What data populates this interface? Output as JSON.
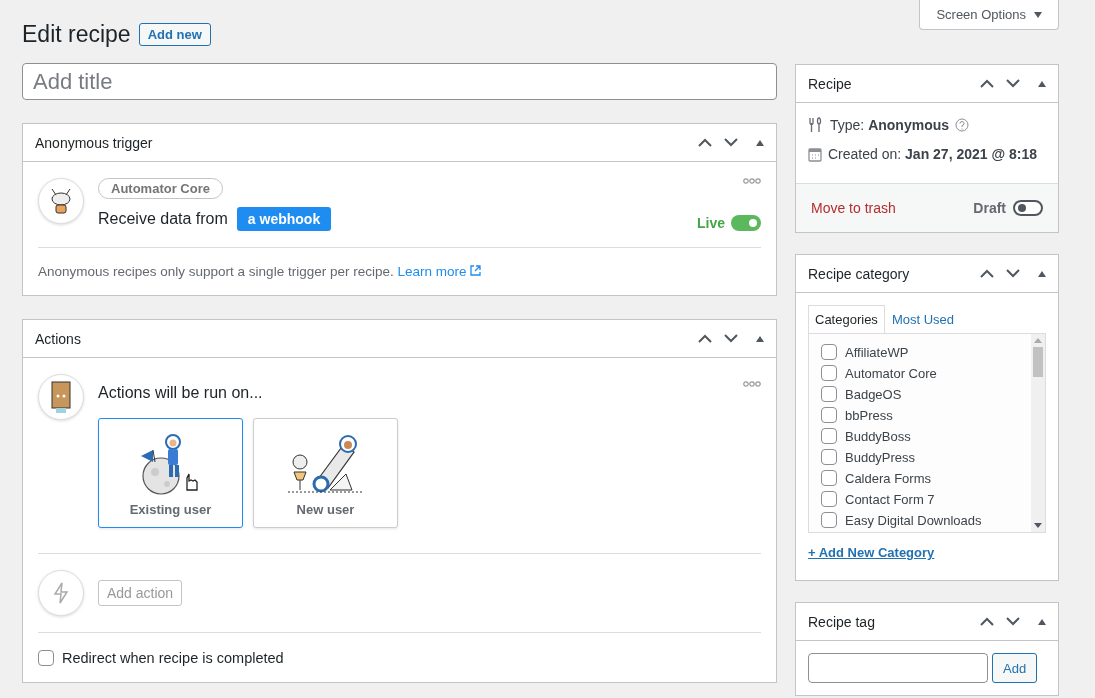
{
  "page": {
    "title": "Edit recipe",
    "add_new": "Add new",
    "screen_options": "Screen Options"
  },
  "title_field": {
    "placeholder": "Add title"
  },
  "trigger_panel": {
    "title": "Anonymous trigger",
    "integration": "Automator Core",
    "sentence": "Receive data from",
    "token": "a webhook",
    "status": {
      "label": "Live",
      "on": true
    },
    "note": "Anonymous recipes only support a single trigger per recipe.",
    "link": "Learn more"
  },
  "actions_panel": {
    "title": "Actions",
    "prompt": "Actions will be run on...",
    "options": [
      {
        "label": "Existing user",
        "selected": true
      },
      {
        "label": "New user",
        "selected": false
      }
    ],
    "add_action": "Add action",
    "redirect": {
      "label": "Redirect when recipe is completed",
      "checked": false
    }
  },
  "recipe_box": {
    "title": "Recipe",
    "type": "Type: **Anonymous**",
    "created": "Created on: **Jan 27, 2021 @ 8:18**",
    "trash": "Move to trash",
    "status": {
      "label": "Draft",
      "on": false
    }
  },
  "category_box": {
    "title": "Recipe category",
    "tabs": [
      {
        "label": "Categories",
        "selected": true
      },
      {
        "label": "Most Used",
        "selected": false
      }
    ],
    "categories": [
      {
        "label": "AffiliateWP",
        "checked": false
      },
      {
        "label": "Automator Core",
        "checked": false
      },
      {
        "label": "BadgeOS",
        "checked": false
      },
      {
        "label": "bbPress",
        "checked": false
      },
      {
        "label": "BuddyBoss",
        "checked": false
      },
      {
        "label": "BuddyPress",
        "checked": false
      },
      {
        "label": "Caldera Forms",
        "checked": false
      },
      {
        "label": "Contact Form 7",
        "checked": false
      },
      {
        "label": "Easy Digital Downloads",
        "checked": false
      }
    ],
    "add_link": "+ Add New Category"
  },
  "tag_box": {
    "title": "Recipe tag",
    "button": "Add"
  }
}
